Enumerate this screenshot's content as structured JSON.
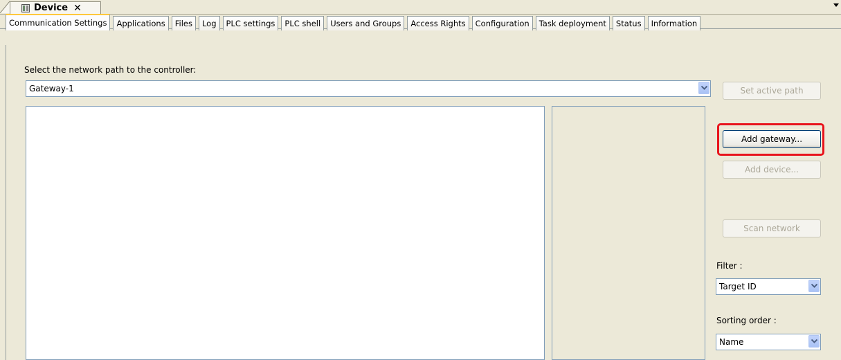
{
  "document_tab": {
    "title": "Device",
    "close_glyph": "✕",
    "icon": "device-icon"
  },
  "tabs": [
    {
      "label": "Communication Settings",
      "active": true
    },
    {
      "label": "Applications",
      "active": false
    },
    {
      "label": "Files",
      "active": false
    },
    {
      "label": "Log",
      "active": false
    },
    {
      "label": "PLC settings",
      "active": false
    },
    {
      "label": "PLC shell",
      "active": false
    },
    {
      "label": "Users and Groups",
      "active": false
    },
    {
      "label": "Access Rights",
      "active": false
    },
    {
      "label": "Configuration",
      "active": false
    },
    {
      "label": "Task deployment",
      "active": false
    },
    {
      "label": "Status",
      "active": false
    },
    {
      "label": "Information",
      "active": false
    }
  ],
  "comm": {
    "path_label": "Select the network path to the controller:",
    "path_value": "Gateway-1",
    "buttons": {
      "set_active_path": "Set active path",
      "add_gateway": "Add gateway...",
      "add_device": "Add device...",
      "scan_network": "Scan network"
    },
    "filter_label": "Filter :",
    "filter_value": "Target ID",
    "sort_label": "Sorting order :",
    "sort_value": "Name"
  },
  "colors": {
    "highlight": "#e8141c",
    "panel_bg": "#ece9d8",
    "active_tab_accent": "#ffc83c"
  }
}
